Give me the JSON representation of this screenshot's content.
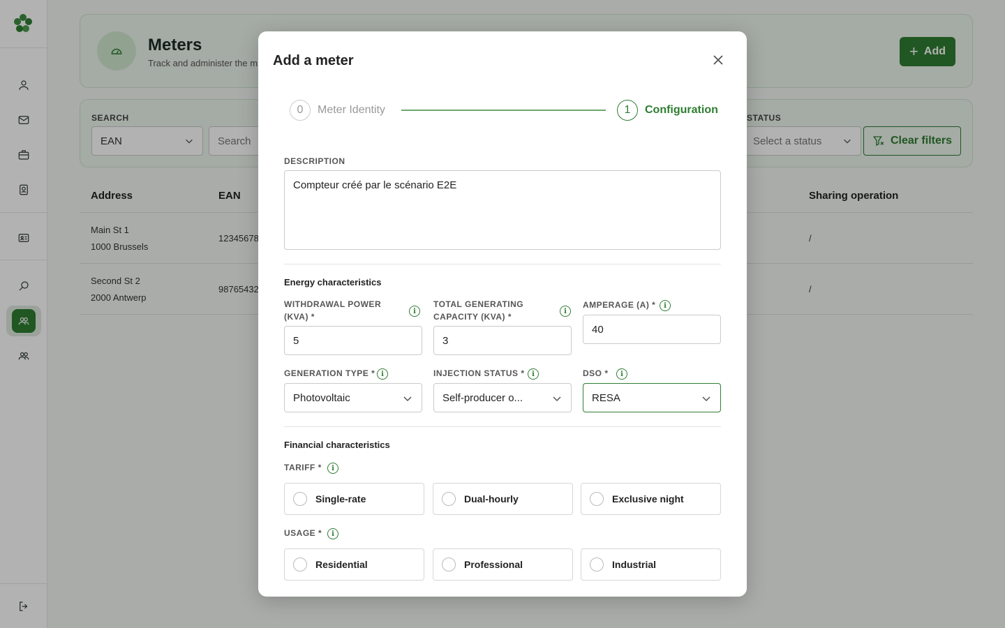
{
  "sidebar": {
    "items": [
      "user-icon",
      "mail-icon",
      "briefcase-icon",
      "contact-icon",
      "id-card-icon",
      "search-icon",
      "users-icon",
      "group-icon"
    ],
    "active_index": 6,
    "logout": "logout-icon"
  },
  "page": {
    "title": "Meters",
    "subtitle": "Track and administer the m",
    "add_label": "Add"
  },
  "filters": {
    "search_label": "SEARCH",
    "search_type": "EAN",
    "search_placeholder": "Search",
    "status_label": "STATUS",
    "status_placeholder": "Select a status",
    "clear_label": "Clear filters"
  },
  "table": {
    "headers": [
      "Address",
      "EAN",
      "Sharing operation"
    ],
    "rows": [
      {
        "street": "Main St 1",
        "city": "1000 Brussels",
        "ean": "12345678",
        "sharing": "/"
      },
      {
        "street": "Second St 2",
        "city": "2000 Antwerp",
        "ean": "98765432",
        "sharing": "/"
      }
    ]
  },
  "modal": {
    "title": "Add a meter",
    "steps": [
      {
        "num": "0",
        "label": "Meter Identity"
      },
      {
        "num": "1",
        "label": "Configuration"
      }
    ],
    "description_label": "DESCRIPTION",
    "description_value": "Compteur créé par le scénario E2E",
    "energy_section": "Energy characteristics",
    "withdrawal_label_1": "WITHDRAWAL POWER",
    "withdrawal_label_2": "(KVA) *",
    "withdrawal_value": "5",
    "generating_label_1": "TOTAL GENERATING",
    "generating_label_2": "CAPACITY (KVA) *",
    "generating_value": "3",
    "amperage_label": "AMPERAGE (A) *",
    "amperage_value": "40",
    "generation_type_label": "GENERATION TYPE *",
    "generation_type_value": "Photovoltaic",
    "injection_label": "INJECTION STATUS *",
    "injection_value": "Self-producer o...",
    "dso_label": "DSO *",
    "dso_value": "RESA",
    "financial_section": "Financial characteristics",
    "tariff_label": "TARIFF *",
    "tariff_options": [
      "Single-rate",
      "Dual-hourly",
      "Exclusive night"
    ],
    "usage_label": "USAGE *",
    "usage_options": [
      "Residential",
      "Professional",
      "Industrial"
    ]
  },
  "colors": {
    "accent": "#2e7d32",
    "accent_light": "#edf5ec"
  }
}
